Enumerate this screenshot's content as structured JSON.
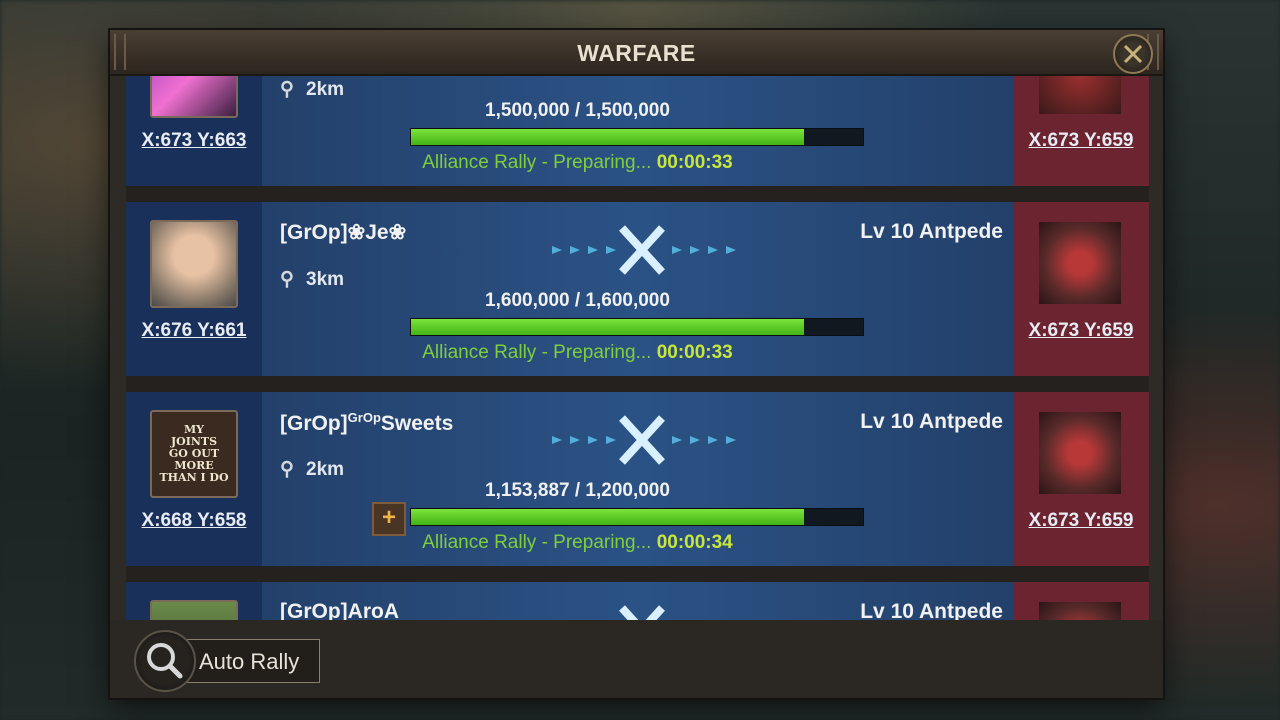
{
  "window": {
    "title": "WARFARE"
  },
  "rows": [
    {
      "player": "",
      "coord": "X:673 Y:663",
      "distance": "2km",
      "target": "",
      "power": "1,500,000 / 1,500,000",
      "progress": 0.87,
      "status": "Alliance Rally - Preparing...",
      "timer": "00:00:33",
      "target_coord": "X:673 Y:659"
    },
    {
      "player": "[GrOp]❀Je❀",
      "coord": "X:676 Y:661",
      "distance": "3km",
      "target": "Lv 10 Antpede",
      "power": "1,600,000 / 1,600,000",
      "progress": 0.87,
      "status": "Alliance Rally - Preparing...",
      "timer": "00:00:33",
      "target_coord": "X:673 Y:659"
    },
    {
      "player_prefix": "[GrOp]",
      "player_sup": "GrOp",
      "player_suffix": "Sweets",
      "coord": "X:668 Y:658",
      "distance": "2km",
      "target": "Lv 10 Antpede",
      "power": "1,153,887 / 1,200,000",
      "progress": 0.87,
      "status": "Alliance Rally - Preparing...",
      "timer": "00:00:34",
      "target_coord": "X:673 Y:659",
      "avatar_text": [
        "MY",
        "JOINTS",
        "GO OUT",
        "MORE",
        "THAN I DO"
      ]
    },
    {
      "player": "[GrOp]AroA",
      "target": "Lv 10 Antpede"
    }
  ],
  "footer": {
    "auto_rally_label": "Auto Rally"
  },
  "icons": {
    "close": "close-x-icon",
    "search": "search-icon",
    "pin": "location-pin-icon",
    "vs": "crossed-swords-icon",
    "plus": "plus-icon"
  },
  "colors": {
    "progress": "#5ecb26",
    "status": "#7fcf3a",
    "row": "#23406a",
    "target_bg": "#6b2430"
  }
}
